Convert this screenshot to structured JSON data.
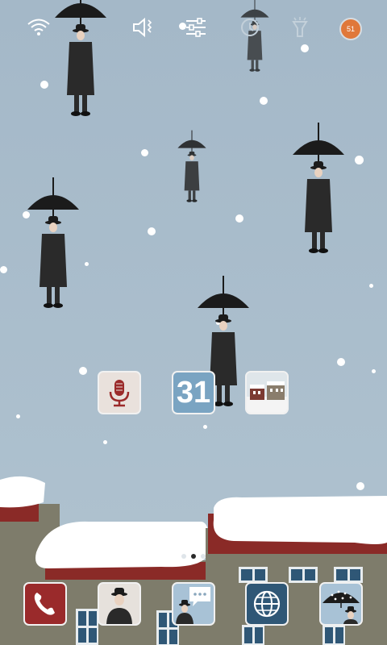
{
  "status_bar": {
    "battery_level": "51",
    "icons": [
      "wifi-icon",
      "vibrate-icon",
      "settings-sliders-icon",
      "sync-icon",
      "flashlight-icon"
    ]
  },
  "home_icons": [
    {
      "name": "voice-recorder-icon"
    },
    {
      "name": "calendar-icon",
      "label": "31"
    },
    {
      "name": "gallery-icon"
    }
  ],
  "dock_icons": [
    {
      "name": "phone-icon"
    },
    {
      "name": "contacts-icon"
    },
    {
      "name": "messages-icon"
    },
    {
      "name": "browser-icon"
    },
    {
      "name": "theme-icon"
    }
  ],
  "page_indicator": {
    "pages": 3,
    "current": 2
  },
  "colors": {
    "sky": "#a8bccb",
    "roof": "#8a2a27",
    "wall": "#7d7b6a",
    "phone_tile": "#9a2a2b",
    "battery": "#e0783a"
  }
}
